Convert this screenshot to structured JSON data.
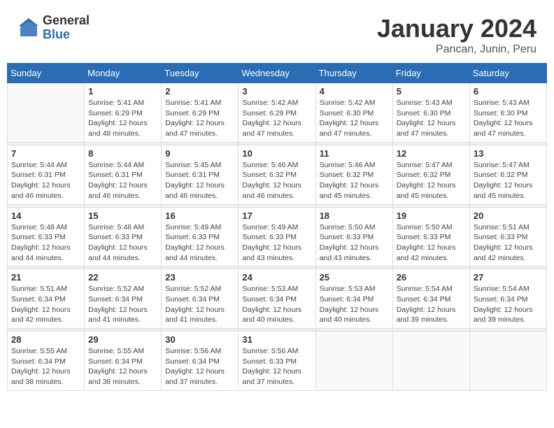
{
  "logo": {
    "general": "General",
    "blue": "Blue"
  },
  "title": {
    "month_year": "January 2024",
    "location": "Pancan, Junin, Peru"
  },
  "weekdays": [
    "Sunday",
    "Monday",
    "Tuesday",
    "Wednesday",
    "Thursday",
    "Friday",
    "Saturday"
  ],
  "weeks": [
    [
      {
        "day": "",
        "sunrise": "",
        "sunset": "",
        "daylight": ""
      },
      {
        "day": "1",
        "sunrise": "Sunrise: 5:41 AM",
        "sunset": "Sunset: 6:29 PM",
        "daylight": "Daylight: 12 hours and 48 minutes."
      },
      {
        "day": "2",
        "sunrise": "Sunrise: 5:41 AM",
        "sunset": "Sunset: 6:29 PM",
        "daylight": "Daylight: 12 hours and 47 minutes."
      },
      {
        "day": "3",
        "sunrise": "Sunrise: 5:42 AM",
        "sunset": "Sunset: 6:29 PM",
        "daylight": "Daylight: 12 hours and 47 minutes."
      },
      {
        "day": "4",
        "sunrise": "Sunrise: 5:42 AM",
        "sunset": "Sunset: 6:30 PM",
        "daylight": "Daylight: 12 hours and 47 minutes."
      },
      {
        "day": "5",
        "sunrise": "Sunrise: 5:43 AM",
        "sunset": "Sunset: 6:30 PM",
        "daylight": "Daylight: 12 hours and 47 minutes."
      },
      {
        "day": "6",
        "sunrise": "Sunrise: 5:43 AM",
        "sunset": "Sunset: 6:30 PM",
        "daylight": "Daylight: 12 hours and 47 minutes."
      }
    ],
    [
      {
        "day": "7",
        "sunrise": "Sunrise: 5:44 AM",
        "sunset": "Sunset: 6:31 PM",
        "daylight": "Daylight: 12 hours and 46 minutes."
      },
      {
        "day": "8",
        "sunrise": "Sunrise: 5:44 AM",
        "sunset": "Sunset: 6:31 PM",
        "daylight": "Daylight: 12 hours and 46 minutes."
      },
      {
        "day": "9",
        "sunrise": "Sunrise: 5:45 AM",
        "sunset": "Sunset: 6:31 PM",
        "daylight": "Daylight: 12 hours and 46 minutes."
      },
      {
        "day": "10",
        "sunrise": "Sunrise: 5:46 AM",
        "sunset": "Sunset: 6:32 PM",
        "daylight": "Daylight: 12 hours and 46 minutes."
      },
      {
        "day": "11",
        "sunrise": "Sunrise: 5:46 AM",
        "sunset": "Sunset: 6:32 PM",
        "daylight": "Daylight: 12 hours and 45 minutes."
      },
      {
        "day": "12",
        "sunrise": "Sunrise: 5:47 AM",
        "sunset": "Sunset: 6:32 PM",
        "daylight": "Daylight: 12 hours and 45 minutes."
      },
      {
        "day": "13",
        "sunrise": "Sunrise: 5:47 AM",
        "sunset": "Sunset: 6:32 PM",
        "daylight": "Daylight: 12 hours and 45 minutes."
      }
    ],
    [
      {
        "day": "14",
        "sunrise": "Sunrise: 5:48 AM",
        "sunset": "Sunset: 6:33 PM",
        "daylight": "Daylight: 12 hours and 44 minutes."
      },
      {
        "day": "15",
        "sunrise": "Sunrise: 5:48 AM",
        "sunset": "Sunset: 6:33 PM",
        "daylight": "Daylight: 12 hours and 44 minutes."
      },
      {
        "day": "16",
        "sunrise": "Sunrise: 5:49 AM",
        "sunset": "Sunset: 6:33 PM",
        "daylight": "Daylight: 12 hours and 44 minutes."
      },
      {
        "day": "17",
        "sunrise": "Sunrise: 5:49 AM",
        "sunset": "Sunset: 6:33 PM",
        "daylight": "Daylight: 12 hours and 43 minutes."
      },
      {
        "day": "18",
        "sunrise": "Sunrise: 5:50 AM",
        "sunset": "Sunset: 6:33 PM",
        "daylight": "Daylight: 12 hours and 43 minutes."
      },
      {
        "day": "19",
        "sunrise": "Sunrise: 5:50 AM",
        "sunset": "Sunset: 6:33 PM",
        "daylight": "Daylight: 12 hours and 42 minutes."
      },
      {
        "day": "20",
        "sunrise": "Sunrise: 5:51 AM",
        "sunset": "Sunset: 6:33 PM",
        "daylight": "Daylight: 12 hours and 42 minutes."
      }
    ],
    [
      {
        "day": "21",
        "sunrise": "Sunrise: 5:51 AM",
        "sunset": "Sunset: 6:34 PM",
        "daylight": "Daylight: 12 hours and 42 minutes."
      },
      {
        "day": "22",
        "sunrise": "Sunrise: 5:52 AM",
        "sunset": "Sunset: 6:34 PM",
        "daylight": "Daylight: 12 hours and 41 minutes."
      },
      {
        "day": "23",
        "sunrise": "Sunrise: 5:52 AM",
        "sunset": "Sunset: 6:34 PM",
        "daylight": "Daylight: 12 hours and 41 minutes."
      },
      {
        "day": "24",
        "sunrise": "Sunrise: 5:53 AM",
        "sunset": "Sunset: 6:34 PM",
        "daylight": "Daylight: 12 hours and 40 minutes."
      },
      {
        "day": "25",
        "sunrise": "Sunrise: 5:53 AM",
        "sunset": "Sunset: 6:34 PM",
        "daylight": "Daylight: 12 hours and 40 minutes."
      },
      {
        "day": "26",
        "sunrise": "Sunrise: 5:54 AM",
        "sunset": "Sunset: 6:34 PM",
        "daylight": "Daylight: 12 hours and 39 minutes."
      },
      {
        "day": "27",
        "sunrise": "Sunrise: 5:54 AM",
        "sunset": "Sunset: 6:34 PM",
        "daylight": "Daylight: 12 hours and 39 minutes."
      }
    ],
    [
      {
        "day": "28",
        "sunrise": "Sunrise: 5:55 AM",
        "sunset": "Sunset: 6:34 PM",
        "daylight": "Daylight: 12 hours and 38 minutes."
      },
      {
        "day": "29",
        "sunrise": "Sunrise: 5:55 AM",
        "sunset": "Sunset: 6:34 PM",
        "daylight": "Daylight: 12 hours and 38 minutes."
      },
      {
        "day": "30",
        "sunrise": "Sunrise: 5:56 AM",
        "sunset": "Sunset: 6:34 PM",
        "daylight": "Daylight: 12 hours and 37 minutes."
      },
      {
        "day": "31",
        "sunrise": "Sunrise: 5:56 AM",
        "sunset": "Sunset: 6:33 PM",
        "daylight": "Daylight: 12 hours and 37 minutes."
      },
      {
        "day": "",
        "sunrise": "",
        "sunset": "",
        "daylight": ""
      },
      {
        "day": "",
        "sunrise": "",
        "sunset": "",
        "daylight": ""
      },
      {
        "day": "",
        "sunrise": "",
        "sunset": "",
        "daylight": ""
      }
    ]
  ]
}
